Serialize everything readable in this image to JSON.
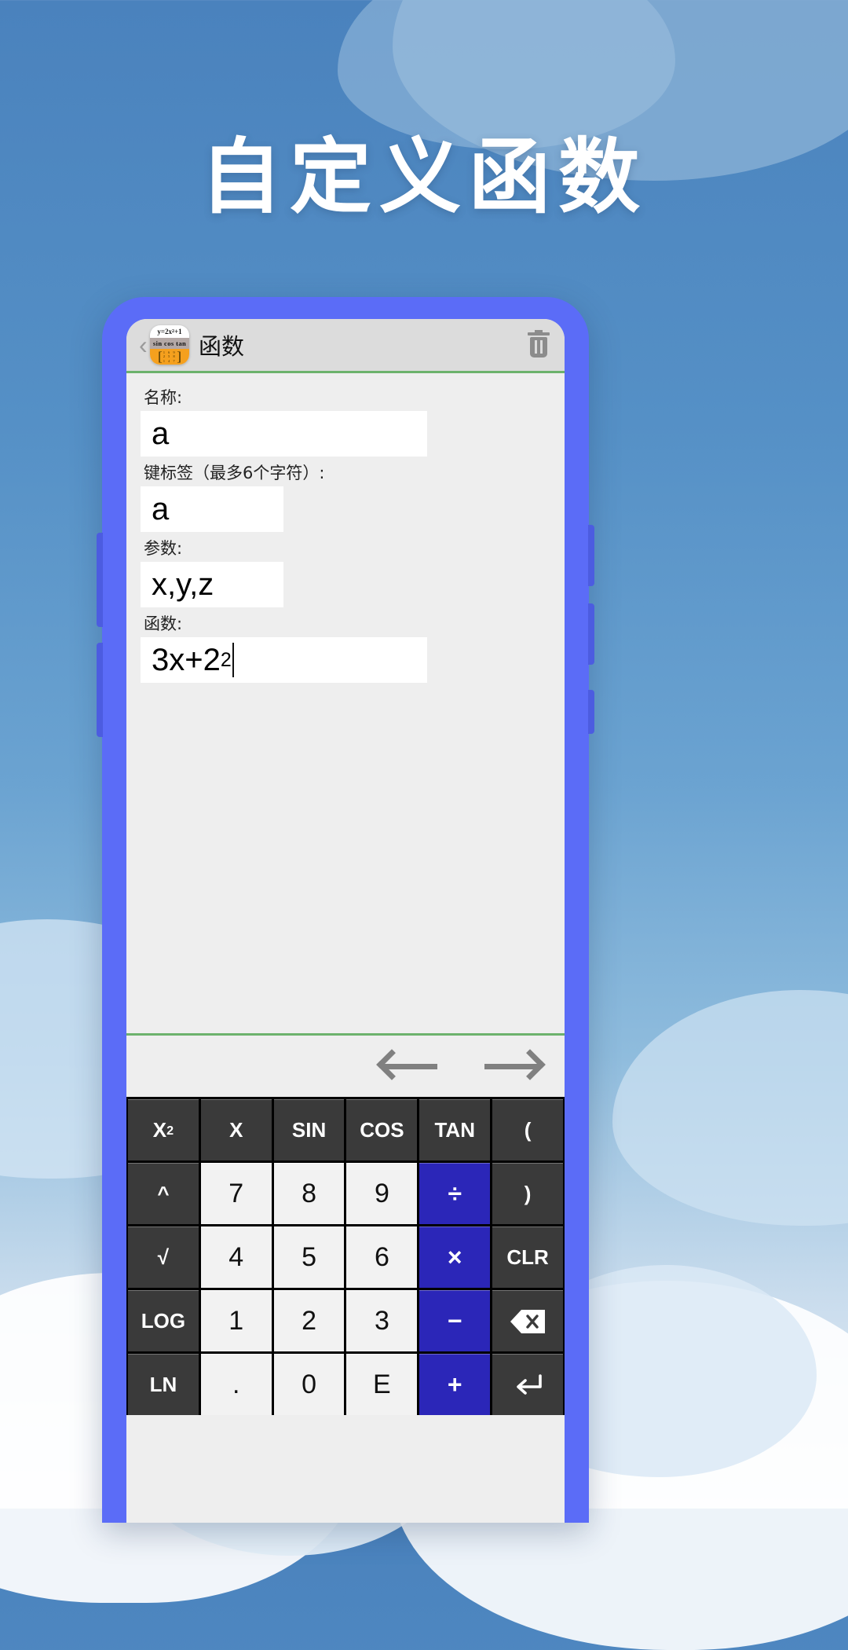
{
  "headline": "自定义函数",
  "app": {
    "title": "函数",
    "icon": {
      "name": "function-calculator-app-icon",
      "formula": "y=2x",
      "formula_exp": "2",
      "formula_tail": "+1",
      "trig": "sin cos tan",
      "matrix_rows": [
        "1 6 9",
        "2 5 8",
        "1 4 7"
      ]
    },
    "back_chevron": "‹",
    "delete_icon": "trash-icon"
  },
  "form": {
    "fields": [
      {
        "label": "名称:",
        "value": "a"
      },
      {
        "label": "键标签（最多6个字符）:",
        "value": "a"
      },
      {
        "label": "参数:",
        "value": "x,y,z"
      },
      {
        "label": "函数:",
        "value": "3x+2",
        "superscript": "2"
      }
    ]
  },
  "nav": {
    "prev": "left-arrow-icon",
    "next": "right-arrow-icon"
  },
  "keypad": {
    "rows": [
      [
        {
          "label": "X",
          "sup": "2",
          "type": "fn"
        },
        {
          "label": "X",
          "type": "fn"
        },
        {
          "label": "SIN",
          "type": "fn"
        },
        {
          "label": "COS",
          "type": "fn"
        },
        {
          "label": "TAN",
          "type": "fn"
        },
        {
          "label": "(",
          "type": "fn"
        }
      ],
      [
        {
          "label": "^",
          "type": "fn"
        },
        {
          "label": "7",
          "type": "num"
        },
        {
          "label": "8",
          "type": "num"
        },
        {
          "label": "9",
          "type": "num"
        },
        {
          "label": "÷",
          "type": "op"
        },
        {
          "label": ")",
          "type": "fn"
        }
      ],
      [
        {
          "label": "√",
          "type": "fn"
        },
        {
          "label": "4",
          "type": "num"
        },
        {
          "label": "5",
          "type": "num"
        },
        {
          "label": "6",
          "type": "num"
        },
        {
          "label": "×",
          "type": "op"
        },
        {
          "label": "CLR",
          "type": "fn"
        }
      ],
      [
        {
          "label": "LOG",
          "type": "fn"
        },
        {
          "label": "1",
          "type": "num"
        },
        {
          "label": "2",
          "type": "num"
        },
        {
          "label": "3",
          "type": "num"
        },
        {
          "label": "−",
          "type": "op"
        },
        {
          "label": "",
          "icon": "backspace-icon",
          "type": "fn"
        }
      ],
      [
        {
          "label": "LN",
          "type": "fn"
        },
        {
          "label": ".",
          "type": "num"
        },
        {
          "label": "0",
          "type": "num"
        },
        {
          "label": "E",
          "type": "num"
        },
        {
          "label": "+",
          "type": "op"
        },
        {
          "label": "↵",
          "icon": "enter-icon",
          "type": "fn"
        }
      ]
    ]
  },
  "colors": {
    "accent_blue": "#5b6cf7",
    "operator_blue": "#2b26b8",
    "function_key": "#3a3a3a",
    "number_key": "#f2f2f2",
    "divider_green": "#6cb26c",
    "appbar_grey": "#dcdcdc"
  }
}
